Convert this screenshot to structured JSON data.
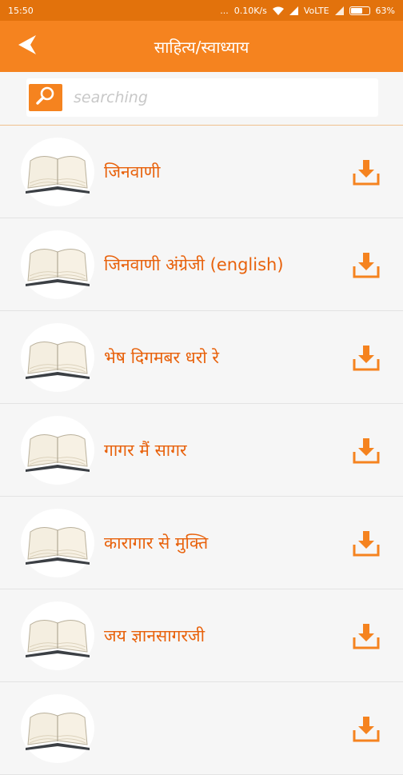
{
  "status_bar": {
    "time": "15:50",
    "dots": "...",
    "network_speed": "0.10K/s",
    "volte": "VoLTE",
    "battery": "63%"
  },
  "header": {
    "title": "साहित्य/स्वाध्याय",
    "back_icon": "arrow-left-icon"
  },
  "search": {
    "placeholder": "searching",
    "icon": "search-icon"
  },
  "colors": {
    "primary": "#f5831f",
    "status_bar": "#e2720c",
    "label": "#e8620c"
  },
  "items": [
    {
      "label": "जिनवाणी"
    },
    {
      "label": "जिनवाणी अंग्रेजी (english)"
    },
    {
      "label": "भेष दिगमबर धरो रे"
    },
    {
      "label": "गागर मैं सागर"
    },
    {
      "label": "कारागार से मुक्ति"
    },
    {
      "label": "जय ज्ञानसागरजी"
    },
    {
      "label": ""
    }
  ]
}
